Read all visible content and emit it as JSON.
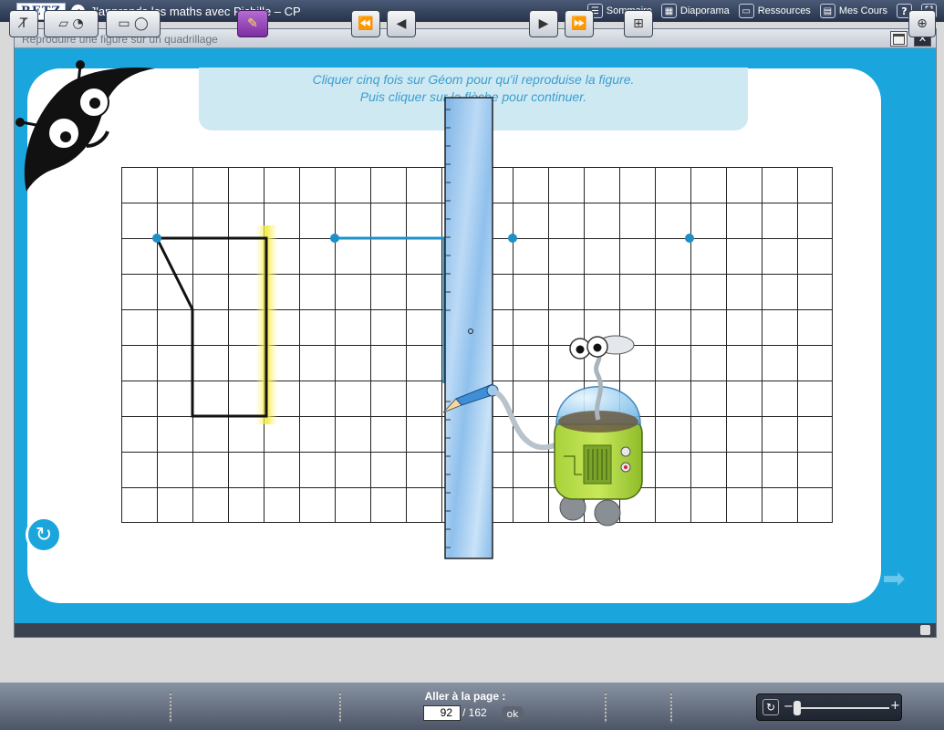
{
  "app": {
    "logo": "RETZ",
    "title": "J'apprends les maths avec Picbille – CP",
    "nav": [
      {
        "label": "Sommaire",
        "icon": "list-icon"
      },
      {
        "label": "Diaporama",
        "icon": "grid-icon"
      },
      {
        "label": "Ressources",
        "icon": "folder-icon"
      },
      {
        "label": "Mes Cours",
        "icon": "book-icon"
      }
    ],
    "help_label": "?"
  },
  "window": {
    "title": "Reproduire une figure sur un quadrillage"
  },
  "exercise": {
    "instruction_line1": "Cliquer cinq fois sur Géom pour qu'il reproduise la figure.",
    "instruction_line2": "Puis cliquer sur la flèche pour continuer."
  },
  "pager": {
    "label": "Aller à la page :",
    "current_page": "92",
    "total": "/ 162",
    "ok_label": "ok"
  },
  "colors": {
    "frame": "#1aa6dc",
    "instruction_text": "#3a9fd0",
    "drawn_line": "#1e90c8"
  }
}
